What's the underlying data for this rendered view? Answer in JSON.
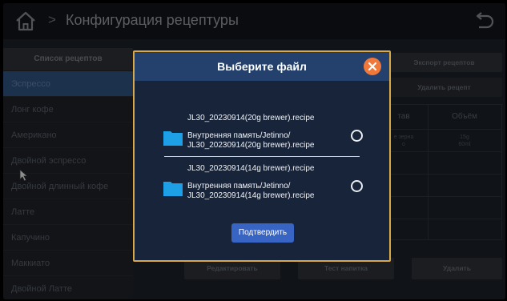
{
  "header": {
    "title": "Конфигурация рецептуры",
    "separator": ">"
  },
  "sidebar": {
    "heading": "Список рецептов",
    "items": [
      {
        "label": "Эспрессо",
        "active": true
      },
      {
        "label": "Лонг кофе"
      },
      {
        "label": "Американо"
      },
      {
        "label": "Двойной эспрессо"
      },
      {
        "label": "Двойной длинный кофе"
      },
      {
        "label": "Латте"
      },
      {
        "label": "Капучино"
      },
      {
        "label": "Маккиато"
      },
      {
        "label": "Двойной Латте"
      }
    ]
  },
  "toolbar": {
    "export_label": "Экспорт рецептов",
    "delete_recipe_label": "Удалить рецепт"
  },
  "table": {
    "col_partial": "тав",
    "col_volume": "Объём",
    "row1_partial_line1": "е зерна",
    "row1_partial_line2": "о",
    "row1_volume_line1": "15g",
    "row1_volume_line2": "60ml"
  },
  "actions": {
    "edit_label": "Редактировать",
    "test_label": "Тест напитка",
    "delete_label": "Удалить"
  },
  "modal": {
    "title": "Выберите файл",
    "files": [
      {
        "name": "JL30_20230914(20g brewer).recipe",
        "path_line1": "Внутренняя память/Jetinno/",
        "path_line2": "JL30_20230914(20g brewer).recipe"
      },
      {
        "name": "JL30_20230914(14g brewer).recipe",
        "path_line1": "Внутренняя память/Jetinno/",
        "path_line2": "JL30_20230914(14g brewer).recipe"
      }
    ],
    "confirm_label": "Подтвердить"
  },
  "colors": {
    "modal_border": "#d9a848",
    "modal_header": "#23416c",
    "close_button": "#f0783a",
    "folder": "#1ea0e6",
    "confirm": "#3864c4",
    "active_item": "#2c4c76"
  },
  "icons": [
    "home-icon",
    "back-icon",
    "close-icon",
    "folder-icon",
    "cursor-icon"
  ]
}
